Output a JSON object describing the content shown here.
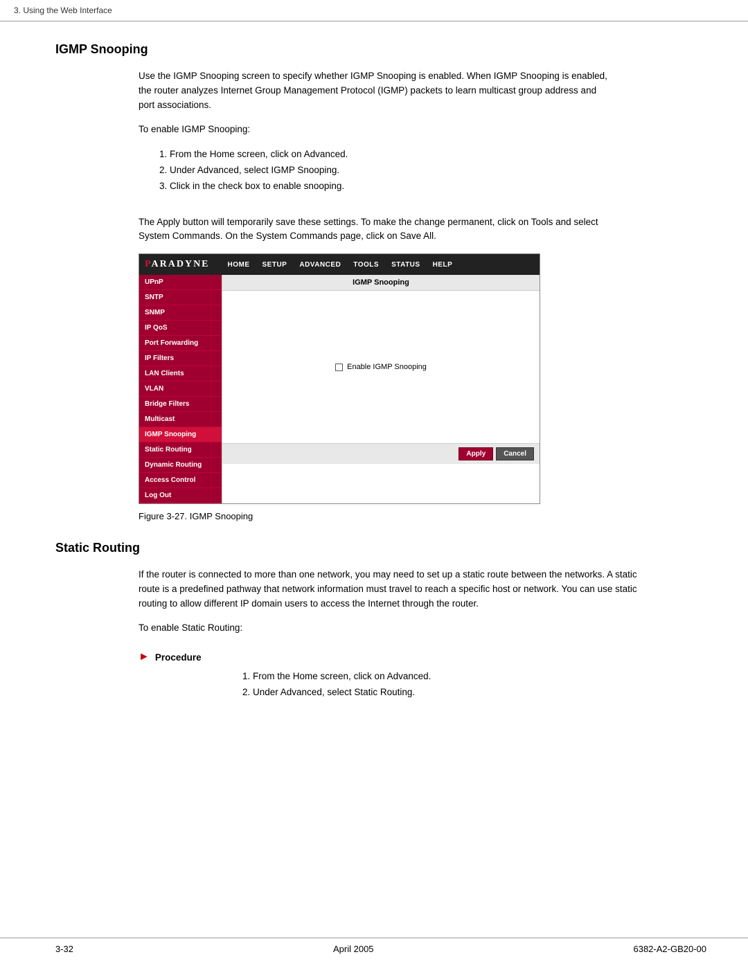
{
  "breadcrumb": "3. Using the Web Interface",
  "igmp_section": {
    "title": "IGMP Snooping",
    "intro": "Use the IGMP Snooping screen to specify whether IGMP Snooping is enabled. When IGMP Snooping is enabled, the router analyzes Internet Group Management Protocol (IGMP) packets to learn multicast group address and port associations.",
    "enable_text": "To enable IGMP Snooping:",
    "steps": [
      "From the Home screen, click on Advanced.",
      "Under Advanced, select IGMP Snooping.",
      "Click in the check box to enable snooping."
    ],
    "apply_note": "The Apply button will temporarily save these settings. To make the change permanent, click on Tools and select System Commands. On the System Commands page, click on Save All.",
    "figure_caption": "Figure 3-27.   IGMP Snooping"
  },
  "router_ui": {
    "logo": "PARADYNE",
    "nav_items": [
      "HOME",
      "SETUP",
      "ADVANCED",
      "TOOLS",
      "STATUS",
      "HELP"
    ],
    "sidebar_items": [
      "UPnP",
      "SNTP",
      "SNMP",
      "IP QoS",
      "Port Forwarding",
      "IP Filters",
      "LAN Clients",
      "VLAN",
      "Bridge Filters",
      "Multicast",
      "IGMP Snooping",
      "Static Routing",
      "Dynamic Routing",
      "Access Control",
      "Log Out"
    ],
    "active_item": "IGMP Snooping",
    "main_header": "IGMP Snooping",
    "checkbox_label": "Enable IGMP Snooping",
    "btn_apply": "Apply",
    "btn_cancel": "Cancel"
  },
  "static_routing_section": {
    "title": "Static Routing",
    "body1": "If the router is connected to more than one network, you may need to set up a static route between the networks. A static route is a predefined pathway that network information must travel to reach a specific host or network. You can use static routing to allow different IP domain users to access the Internet through the router.",
    "enable_text": "To enable Static Routing:",
    "procedure_label": "Procedure",
    "steps": [
      "From the Home screen, click on Advanced.",
      "Under Advanced, select Static Routing."
    ]
  },
  "footer": {
    "page_num": "3-32",
    "date": "April 2005",
    "doc_id": "6382-A2-GB20-00"
  }
}
